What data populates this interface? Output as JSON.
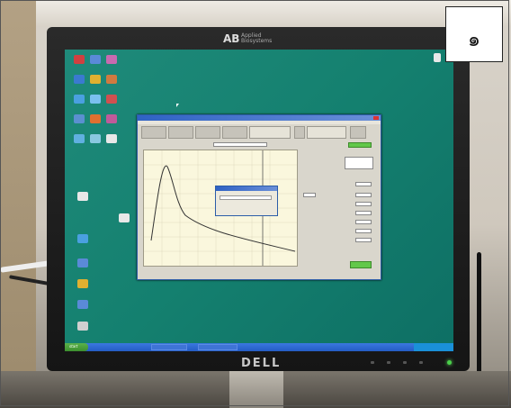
{
  "photo": {
    "corner_label": "๑",
    "monitor_brand": "DELL",
    "top_logo_mark": "AB",
    "top_logo_text": "Applied Biosystems"
  },
  "desktop": {
    "background_color": "#14806f",
    "icons": [
      {
        "name": "icon-1",
        "label": "",
        "color": "#d04040"
      },
      {
        "name": "icon-2",
        "label": "",
        "color": "#5a8ad8"
      },
      {
        "name": "icon-3",
        "label": "",
        "color": "#c86ab0"
      },
      {
        "name": "icon-4",
        "label": "",
        "color": "#3a7ad0"
      },
      {
        "name": "icon-5",
        "label": "",
        "color": "#e0b030"
      },
      {
        "name": "icon-6",
        "label": "",
        "color": "#d07a40"
      },
      {
        "name": "icon-7",
        "label": "",
        "color": "#4aa0e0"
      },
      {
        "name": "icon-8",
        "label": "",
        "color": "#7ac0f0"
      },
      {
        "name": "icon-9",
        "label": "",
        "color": "#d05050"
      },
      {
        "name": "icon-10",
        "label": "",
        "color": "#5a90d0"
      },
      {
        "name": "icon-11",
        "label": "",
        "color": "#e07030"
      },
      {
        "name": "icon-12",
        "label": "",
        "color": "#c05a9a"
      },
      {
        "name": "icon-13",
        "label": "",
        "color": "#60b0e0"
      },
      {
        "name": "icon-14",
        "label": "",
        "color": "#8ac8e0"
      },
      {
        "name": "icon-15",
        "label": "",
        "color": "#e8e8e8"
      }
    ]
  },
  "app": {
    "title": "",
    "accent": "#2f62c4",
    "plot_bg": "#faf7dd",
    "dialog_title": "",
    "green_button": "#62c84a"
  },
  "taskbar": {
    "start_label": "start",
    "color": "#245cc4"
  }
}
